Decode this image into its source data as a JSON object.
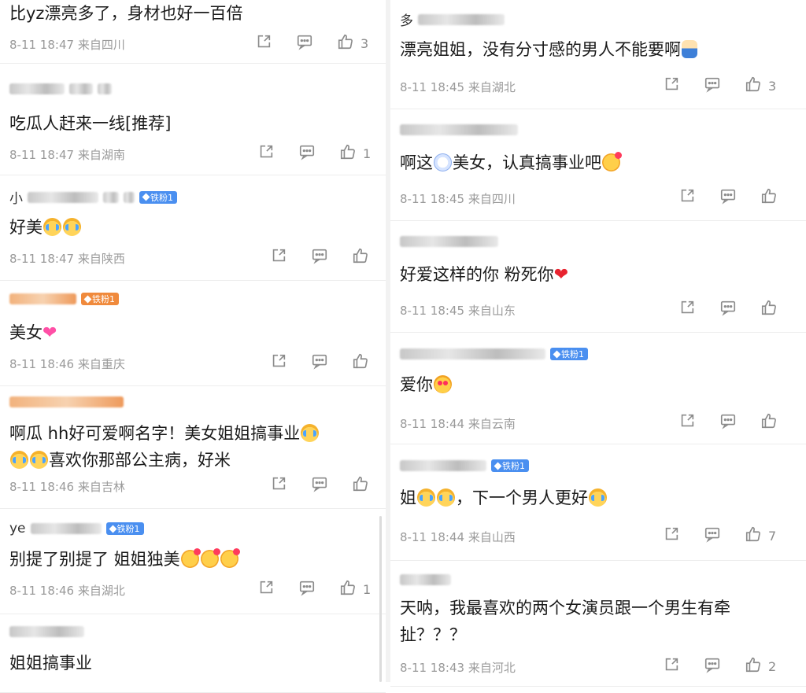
{
  "left_comments": [
    {
      "user": "",
      "badge": "",
      "text_parts": [
        {
          "t": "比yz漂亮多了，身材也好一百倍"
        }
      ],
      "time": "8-11 18:47",
      "location": "来自四川",
      "likes": "3"
    },
    {
      "user": "",
      "badge": "",
      "text_parts": [
        {
          "t": "吃瓜人赶来一线[推荐]"
        }
      ],
      "time": "8-11 18:47",
      "location": "来自湖南",
      "likes": "1"
    },
    {
      "user": "小",
      "badge": "铁粉1",
      "text_parts": [
        {
          "t": "好美"
        },
        {
          "e": "cry"
        },
        {
          "e": "cry"
        }
      ],
      "time": "8-11 18:47",
      "location": "来自陕西",
      "likes": ""
    },
    {
      "user": "",
      "badge": "铁粉1",
      "text_parts": [
        {
          "t": "美女"
        },
        {
          "h": "pink"
        }
      ],
      "time": "8-11 18:46",
      "location": "来自重庆",
      "likes": ""
    },
    {
      "user": "",
      "badge": "",
      "text_parts": [
        {
          "t": "啊瓜 hh好可爱啊名字！美女姐姐搞事业"
        },
        {
          "e": "cry"
        },
        {
          "br": true
        },
        {
          "e": "cry"
        },
        {
          "e": "cry"
        },
        {
          "t": "喜欢你那部公主病，好米"
        }
      ],
      "time": "8-11 18:46",
      "location": "来自吉林",
      "likes": ""
    },
    {
      "user": "ye",
      "badge": "铁粉1",
      "text_parts": [
        {
          "t": "别提了别提了  姐姐独美"
        },
        {
          "e": "kiss"
        },
        {
          "e": "kiss"
        },
        {
          "e": "kiss"
        }
      ],
      "time": "8-11 18:46",
      "location": "来自湖北",
      "likes": "1"
    },
    {
      "user": "",
      "badge": "",
      "text_parts": [
        {
          "t": "姐姐搞事业"
        }
      ],
      "time": "",
      "location": "",
      "likes": ""
    }
  ],
  "right_comments": [
    {
      "user": "多",
      "badge": "",
      "text_parts": [
        {
          "t": "漂亮姐姐，没有分寸感的男人不能要啊"
        },
        {
          "e": "baby"
        }
      ],
      "time": "8-11 18:45",
      "location": "来自湖北",
      "likes": "3"
    },
    {
      "user": "",
      "badge": "",
      "text_parts": [
        {
          "t": "啊这"
        },
        {
          "e": "doubt"
        },
        {
          "t": "美女，认真搞事业吧"
        },
        {
          "e": "kiss"
        }
      ],
      "time": "8-11 18:45",
      "location": "来自四川",
      "likes": ""
    },
    {
      "user": "",
      "badge": "",
      "text_parts": [
        {
          "t": "好爱这样的你 粉死你"
        },
        {
          "h": "red"
        }
      ],
      "time": "8-11 18:45",
      "location": "来自山东",
      "likes": ""
    },
    {
      "user": "",
      "badge": "铁粉1",
      "text_parts": [
        {
          "t": "爱你"
        },
        {
          "e": "love"
        }
      ],
      "time": "8-11 18:44",
      "location": "来自云南",
      "likes": ""
    },
    {
      "user": "",
      "badge": "铁粉1",
      "text_parts": [
        {
          "t": "姐"
        },
        {
          "e": "cry"
        },
        {
          "e": "cry"
        },
        {
          "t": "，下一个男人更好"
        },
        {
          "e": "cry"
        }
      ],
      "time": "8-11 18:44",
      "location": "来自山西",
      "likes": "7"
    },
    {
      "user": "",
      "badge": "",
      "text_parts": [
        {
          "t": "天呐，我最喜欢的两个女演员跟一个男生有牵"
        },
        {
          "br": true
        },
        {
          "t": "扯？？？"
        }
      ],
      "time": "8-11 18:43",
      "location": "来自河北",
      "likes": "2"
    }
  ]
}
